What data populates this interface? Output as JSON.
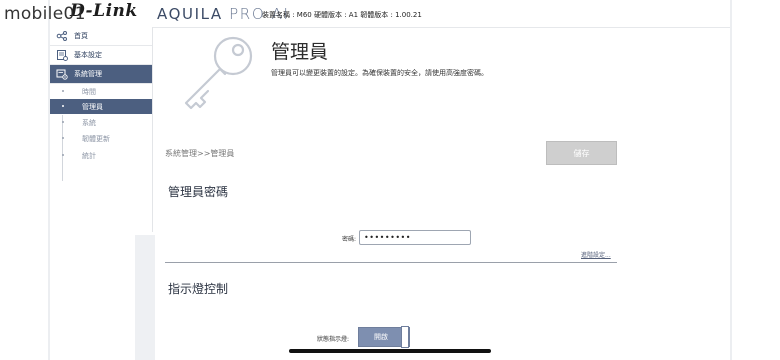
{
  "watermark": {
    "text": "mobile01"
  },
  "header": {
    "brand_dlink": "D-Link",
    "brand_aquila": "AQUILA",
    "brand_pro": "PRO AI",
    "device_info": "裝置名稱 : M60  硬體版本 : A1  韌體版本 : 1.00.21"
  },
  "sidebar": {
    "items": [
      {
        "label": "首頁",
        "icon": "network-icon"
      },
      {
        "label": "基本設定",
        "icon": "settings-doc-icon"
      },
      {
        "label": "系統管理",
        "icon": "admin-gear-icon"
      }
    ],
    "sub_items": [
      {
        "label": "時間"
      },
      {
        "label": "管理員"
      },
      {
        "label": "系統"
      },
      {
        "label": "韌體更新"
      },
      {
        "label": "統計"
      }
    ]
  },
  "page": {
    "title": "管理員",
    "description": "管理員可以變更裝置的設定。為確保裝置的安全，請使用高強度密碼。",
    "breadcrumb": "系統管理>>管理員",
    "save_label": "儲存"
  },
  "password_section": {
    "title": "管理員密碼",
    "label": "密碼:",
    "value": "•••••••••",
    "advanced_link": "進階設定..."
  },
  "led_section": {
    "title": "指示燈控制",
    "label": "狀態指示燈:",
    "toggle_text": "開啟",
    "toggle_on": true
  },
  "colors": {
    "accent": "#4c5f80",
    "toggle": "#7e8fb0",
    "save_disabled": "#cfcfcf"
  }
}
